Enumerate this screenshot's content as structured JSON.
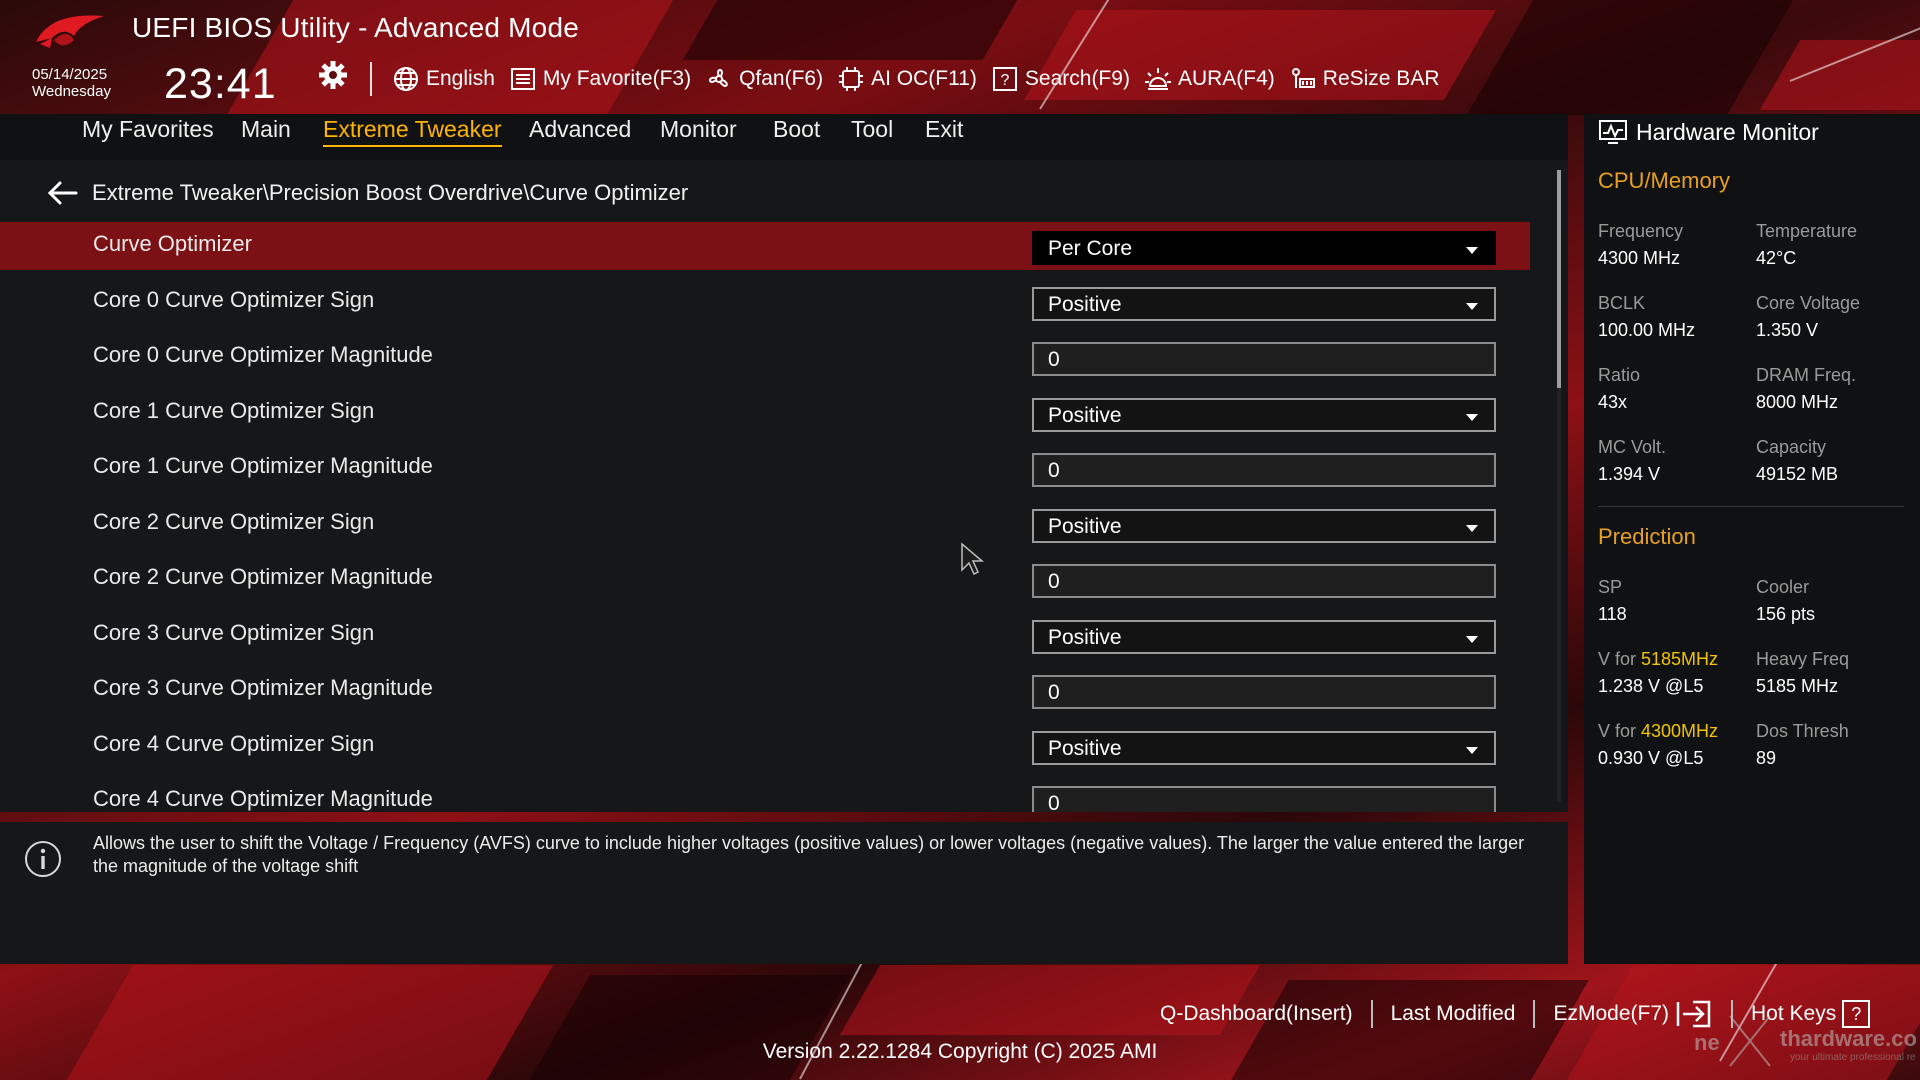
{
  "header": {
    "title": "UEFI BIOS Utility - Advanced Mode",
    "date": "05/14/2025",
    "day": "Wednesday",
    "time": "23:41",
    "toolbar": [
      {
        "label": "English",
        "icon": "globe-icon"
      },
      {
        "label": "My Favorite(F3)",
        "icon": "favorite-list-icon"
      },
      {
        "label": "Qfan(F6)",
        "icon": "fan-icon"
      },
      {
        "label": "AI OC(F11)",
        "icon": "ai-chip-icon"
      },
      {
        "label": "Search(F9)",
        "icon": "search-help-icon"
      },
      {
        "label": "AURA(F4)",
        "icon": "aura-light-icon"
      },
      {
        "label": "ReSize BAR",
        "icon": "resize-bar-icon"
      }
    ]
  },
  "menu": {
    "tabs": [
      "My Favorites",
      "Main",
      "Extreme Tweaker",
      "Advanced",
      "Monitor",
      "Boot",
      "Tool",
      "Exit"
    ],
    "active": "Extreme Tweaker"
  },
  "main": {
    "breadcrumb": "Extreme Tweaker\\Precision Boost Overdrive\\Curve Optimizer",
    "rows": [
      {
        "label": "Curve Optimizer",
        "type": "dropdown",
        "value": "Per Core",
        "selected": true
      },
      {
        "label": "Core 0 Curve Optimizer Sign",
        "type": "dropdown",
        "value": "Positive"
      },
      {
        "label": "Core 0 Curve Optimizer Magnitude",
        "type": "input",
        "value": "0"
      },
      {
        "label": "Core 1 Curve Optimizer Sign",
        "type": "dropdown",
        "value": "Positive"
      },
      {
        "label": "Core 1 Curve Optimizer Magnitude",
        "type": "input",
        "value": "0"
      },
      {
        "label": "Core 2 Curve Optimizer Sign",
        "type": "dropdown",
        "value": "Positive"
      },
      {
        "label": "Core 2 Curve Optimizer Magnitude",
        "type": "input",
        "value": "0"
      },
      {
        "label": "Core 3 Curve Optimizer Sign",
        "type": "dropdown",
        "value": "Positive"
      },
      {
        "label": "Core 3 Curve Optimizer Magnitude",
        "type": "input",
        "value": "0"
      },
      {
        "label": "Core 4 Curve Optimizer Sign",
        "type": "dropdown",
        "value": "Positive"
      },
      {
        "label": "Core 4 Curve Optimizer Magnitude",
        "type": "input",
        "value": "0"
      }
    ]
  },
  "help": {
    "text": "Allows the user to shift the Voltage / Frequency (AVFS) curve to include higher voltages (positive values) or lower voltages (negative values). The larger the value entered the larger the magnitude of the voltage shift"
  },
  "hardware_monitor": {
    "title": "Hardware Monitor",
    "cpu_memory": {
      "title": "CPU/Memory",
      "items": [
        {
          "label": "Frequency",
          "value": "4300 MHz"
        },
        {
          "label": "Temperature",
          "value": "42°C"
        },
        {
          "label": "BCLK",
          "value": "100.00 MHz"
        },
        {
          "label": "Core Voltage",
          "value": "1.350 V"
        },
        {
          "label": "Ratio",
          "value": "43x"
        },
        {
          "label": "DRAM Freq.",
          "value": "8000 MHz"
        },
        {
          "label": "MC Volt.",
          "value": "1.394 V"
        },
        {
          "label": "Capacity",
          "value": "49152 MB"
        }
      ]
    },
    "prediction": {
      "title": "Prediction",
      "sp_label": "SP",
      "sp_value": "118",
      "cooler_label": "Cooler",
      "cooler_value": "156 pts",
      "vfor1_prefix": "V for ",
      "vfor1_freq": "5185MHz",
      "vfor1_value": "1.238 V @L5",
      "heavy_label": "Heavy Freq",
      "heavy_value": "5185 MHz",
      "vfor2_prefix": "V for ",
      "vfor2_freq": "4300MHz",
      "vfor2_value": "0.930 V @L5",
      "dos_label": "Dos Thresh",
      "dos_value": "89"
    }
  },
  "footer": {
    "qdashboard": "Q-Dashboard(Insert)",
    "last_modified": "Last Modified",
    "ezmode": "EzMode(F7)",
    "hotkeys": "Hot Keys",
    "hotkeys_icon": "?",
    "version": "Version 2.22.1284 Copyright (C) 2025 AMI"
  },
  "colors": {
    "accent": "#ffb400",
    "section_title": "#e8a020",
    "selected_row": "#7b1015",
    "highlight_freq": "#f2c500"
  }
}
